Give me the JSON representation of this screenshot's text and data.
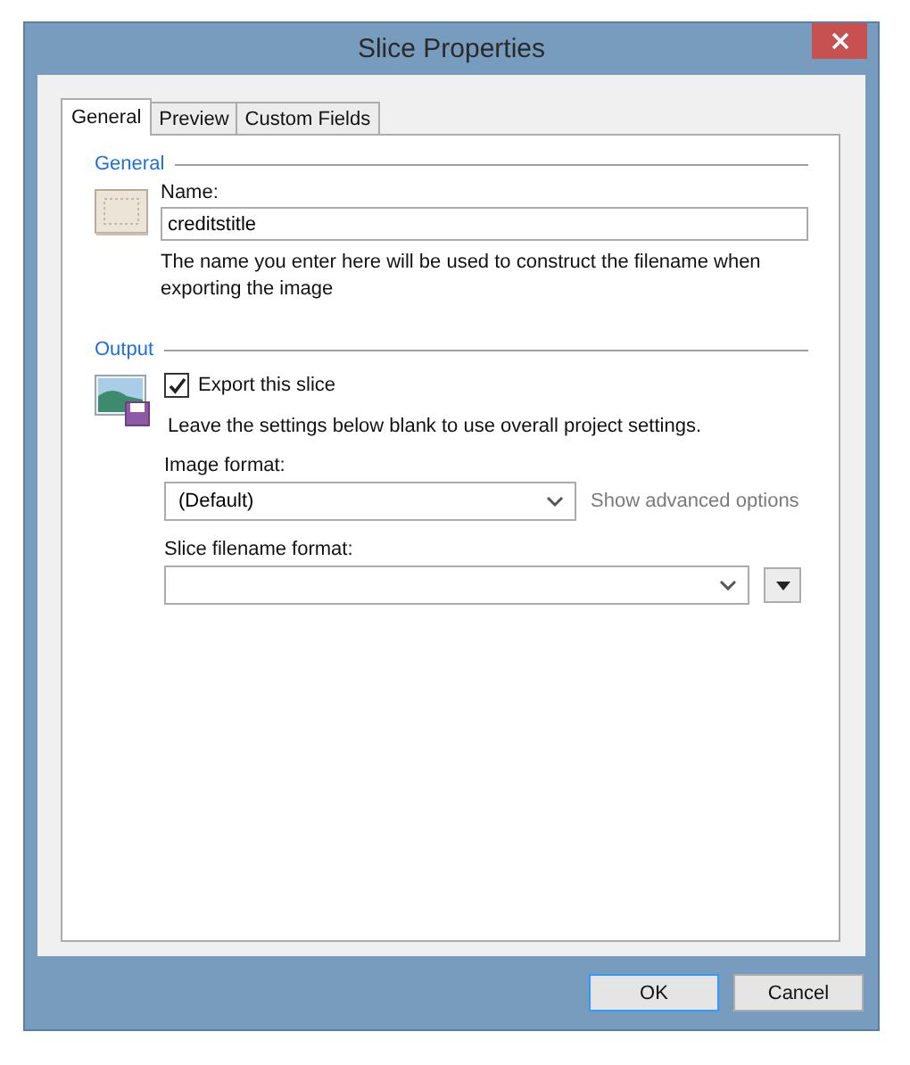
{
  "window": {
    "title": "Slice Properties"
  },
  "tabs": [
    {
      "label": "General",
      "selected": true
    },
    {
      "label": "Preview",
      "selected": false
    },
    {
      "label": "Custom Fields",
      "selected": false
    }
  ],
  "general": {
    "heading": "General",
    "name_label": "Name:",
    "name_value": "creditstitle",
    "hint": "The name you enter here will be used to construct the filename when exporting the image"
  },
  "output": {
    "heading": "Output",
    "export_label": "Export this slice",
    "export_checked": true,
    "note": "Leave the settings below blank to use overall project settings.",
    "image_format_label": "Image format:",
    "image_format_value": "(Default)",
    "advanced_link": "Show advanced options",
    "filename_format_label": "Slice filename format:"
  },
  "buttons": [
    {
      "label": "OK",
      "default": true
    },
    {
      "label": "Cancel",
      "default": false
    }
  ]
}
